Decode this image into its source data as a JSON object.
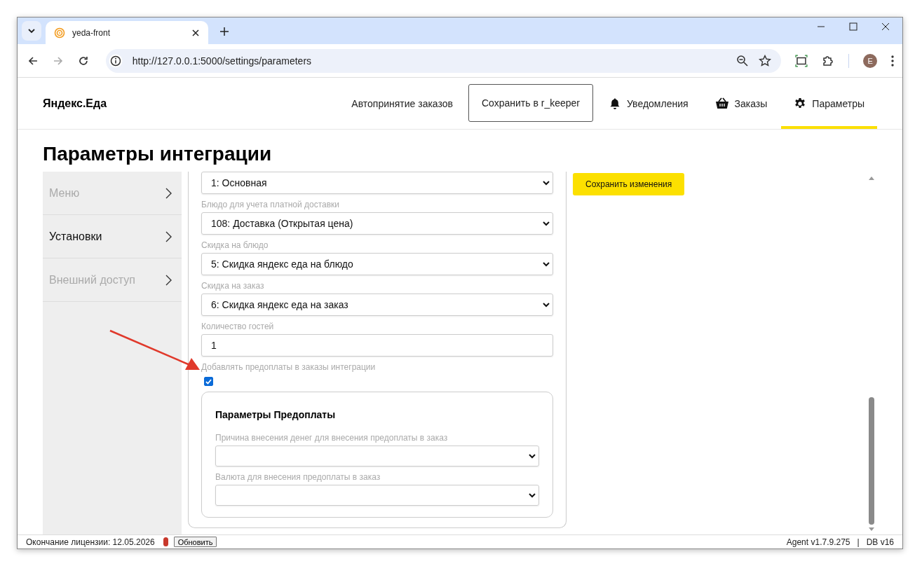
{
  "browser": {
    "tab_title": "yeda-front",
    "url": "http://127.0.0.1:5000/settings/parameters",
    "profile_initial": "E"
  },
  "header": {
    "brand": "Яндекс.Еда",
    "nav": [
      {
        "kind": "link",
        "label": "Автопринятие заказов",
        "selected": false
      },
      {
        "kind": "outlined",
        "label": "Сохранить в r_keeper",
        "selected": false
      },
      {
        "kind": "bell",
        "label": "Уведомления",
        "selected": false
      },
      {
        "kind": "basket",
        "label": "Заказы",
        "selected": false
      },
      {
        "kind": "gear",
        "label": "Параметры",
        "selected": true
      }
    ]
  },
  "page_title": "Параметры интеграции",
  "sidebar": {
    "items": [
      {
        "label": "Меню",
        "selected": false
      },
      {
        "label": "Установки",
        "selected": true
      },
      {
        "label": "Внешний доступ",
        "selected": false
      }
    ]
  },
  "form": {
    "fields": [
      {
        "kind": "select",
        "value": "1: Основная"
      },
      {
        "kind": "select",
        "label": "Блюдо для учета платной доставки",
        "value": "108: Доставка (Открытая цена)"
      },
      {
        "kind": "select",
        "label": "Скидка на блюдо",
        "value": "5: Скидка яндекс еда на блюдо"
      },
      {
        "kind": "select",
        "label": "Скидка на заказ",
        "value": "6: Скидка яндекс еда на заказ"
      },
      {
        "kind": "text",
        "label": "Количество гостей",
        "value": "1"
      },
      {
        "kind": "checkbox",
        "label": "Добавлять предоплаты в заказы интеграции",
        "checked": true
      }
    ],
    "prepayment": {
      "title": "Параметры Предоплаты",
      "fields": [
        {
          "kind": "select",
          "label": "Причина внесения денег для внесения предоплаты в заказ"
        },
        {
          "kind": "select",
          "label": "Валюта для внесения предоплаты в заказ"
        }
      ]
    }
  },
  "save_button": "Сохранить изменения",
  "status_bar": {
    "license": "Окончание лицензии: 12.05.2026",
    "license_status": {
      "color": "#c8382c"
    },
    "refresh_button": "Обновить",
    "agent_version": "Agent v1.7.9.275",
    "separator": "|",
    "db_version": "DB v16"
  }
}
